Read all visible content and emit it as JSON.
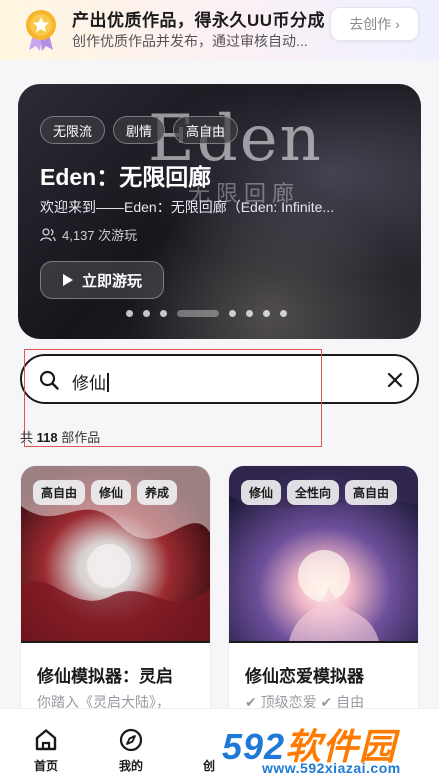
{
  "banner": {
    "title": "产出优质作品，得永久UU币分成",
    "subtitle": "创作优质作品并发布，通过审核自动...",
    "button_label": "去创作 ›"
  },
  "hero": {
    "watermark": "Eden",
    "watermark_cn": "无限回廊",
    "tags": [
      "无限流",
      "剧情",
      "高自由"
    ],
    "title": "Eden：无限回廊",
    "description": "欢迎来到——Eden：无限回廊（Eden: Infinite...",
    "plays": "4,137 次游玩",
    "play_button": "立即游玩"
  },
  "search": {
    "query": "修仙",
    "results_prefix": "共",
    "results_count": "118",
    "results_suffix": "部作品"
  },
  "cards": [
    {
      "tags": [
        "高自由",
        "修仙",
        "养成"
      ],
      "title": "修仙模拟器：灵启",
      "description": "你踏入《灵启大陆》，"
    },
    {
      "tags": [
        "修仙",
        "全性向",
        "高自由"
      ],
      "title": "修仙恋爱模拟器",
      "description": "✔ 顶级恋爱 ✔ 自由"
    }
  ],
  "nav": {
    "home": "首页",
    "mine": "我的",
    "create": "创"
  },
  "watermark": {
    "brand_digits": "592",
    "brand_text": "软件园",
    "url": "www.592xiazai.com"
  },
  "colors": {
    "accent": "#1a1a1a",
    "highlight_box": "#e05555",
    "watermark_blue": "#1e7ad6",
    "watermark_orange": "#ff7a00"
  }
}
